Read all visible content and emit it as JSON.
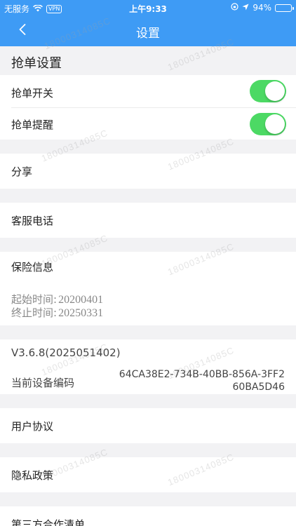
{
  "status_bar": {
    "carrier": "无服务",
    "vpn": "VPN",
    "time": "上午9:33",
    "battery": "94%",
    "battery_level": 0.94
  },
  "nav": {
    "title": "设置",
    "back_icon": "chevron-left-icon"
  },
  "grab": {
    "section_title": "抢单设置",
    "switch_label": "抢单开关",
    "switch_on": true,
    "remind_label": "抢单提醒",
    "remind_on": true
  },
  "menu": {
    "share": "分享",
    "service_phone": "客服电话",
    "insurance": "保险信息",
    "user_agreement": "用户协议",
    "privacy_policy": "隐私政策",
    "third_party": "第三方合作清单"
  },
  "insurance": {
    "start_label": "起始时间:",
    "start_value": "20200401",
    "end_label": "终止时间:",
    "end_value": "20250331"
  },
  "about": {
    "version": "V3.6.8(2025051402)",
    "device_label": "当前设备编码",
    "device_code": "64CA38E2-734B-40BB-856A-3FF260BA5D46"
  },
  "watermark": "18000314085C",
  "colors": {
    "brand": "#3e9bf5",
    "switch_on": "#4cd964"
  }
}
